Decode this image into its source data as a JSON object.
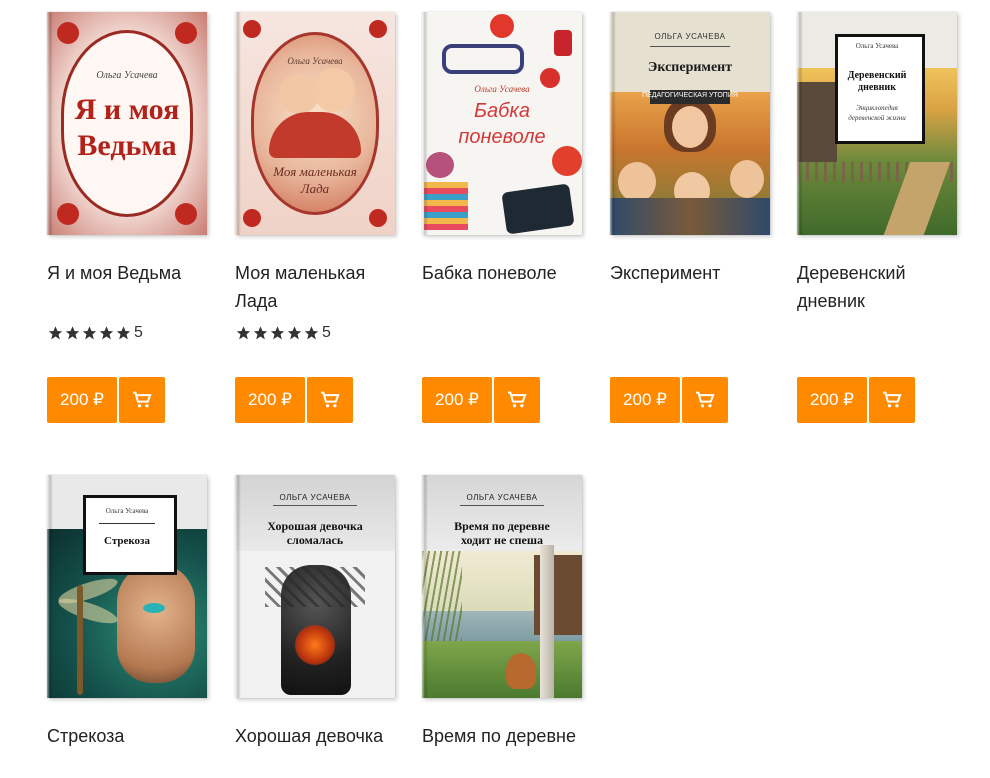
{
  "colors": {
    "accent": "#ff8a00",
    "star": "#333333"
  },
  "cart_icon": "cart-icon",
  "books": [
    {
      "title": "Я и моя Ведьма",
      "rating": "5",
      "price": "200 ₽",
      "cover": {
        "author": "Ольга Усачева",
        "title_line1": "Я и моя",
        "title_line2": "Ведьма"
      }
    },
    {
      "title": "Моя маленькая Лада",
      "rating": "5",
      "price": "200 ₽",
      "cover": {
        "author": "Ольга Усачева",
        "title_line1": "Моя маленькая",
        "title_line2": "Лада"
      }
    },
    {
      "title": "Бабка поневоле",
      "price": "200 ₽",
      "cover": {
        "author": "Ольга Усачева",
        "title_line1": "Бабка",
        "title_line2": "поневоле"
      }
    },
    {
      "title": "Эксперимент",
      "price": "200 ₽",
      "cover": {
        "author": "ОЛЬГА УСАЧЕВА",
        "title": "Эксперимент",
        "subtitle": "ПЕДАГОГИЧЕСКАЯ УТОПИЯ"
      }
    },
    {
      "title": "Деревенский дневник",
      "price": "200 ₽",
      "cover": {
        "author": "Ольга Усачева",
        "title_line1": "Деревенский",
        "title_line2": "дневник",
        "subtitle_line1": "Энциклопедия",
        "subtitle_line2": "деревенской жизни"
      }
    },
    {
      "title": "Стрекоза",
      "cover": {
        "author": "Ольга Усачева",
        "title": "Стрекоза"
      }
    },
    {
      "title": "Хорошая девочка",
      "cover": {
        "author": "ОЛЬГА УСАЧЕВА",
        "title_line1": "Хорошая девочка",
        "title_line2": "сломалась"
      }
    },
    {
      "title": "Время по деревне",
      "cover": {
        "author": "ОЛЬГА УСАЧЕВА",
        "title_line1": "Время по деревне",
        "title_line2": "ходит не спеша"
      }
    }
  ]
}
